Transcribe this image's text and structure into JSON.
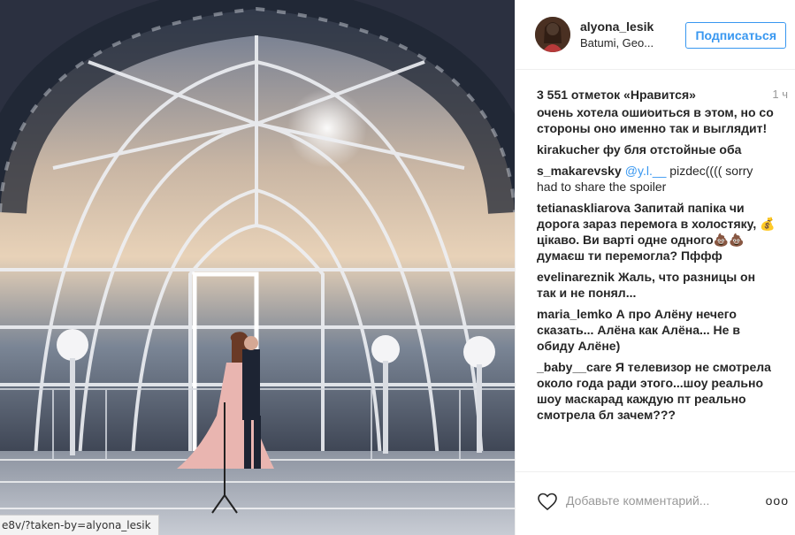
{
  "photo": {
    "description_icon": "wedding-photo"
  },
  "status_bar": {
    "url": "e8v/?taken-by=alyona_lesik"
  },
  "post": {
    "username": "alyona_lesik",
    "location": "Batumi, Geo...",
    "follow_label": "Подписаться",
    "likes": "3 551 отметок «Нравится»",
    "time": "1 ч",
    "comments": [
      {
        "author": "",
        "text": "очень хотела ошибиться в этом, но со стороны оно именно так и выглядит!"
      },
      {
        "author": "kirakucher",
        "text": "фу бля отстойные оба"
      },
      {
        "author": "s_makarevsky",
        "mention": "@y.l.__",
        "text": " pizdec(((( sorry had to share the spoiler"
      },
      {
        "author": "tetianaskliarova",
        "text": "Запитай папіка чи дорога зараз перемога в холостяку, 💰 цікаво. Ви варті одне одного💩💩 думаєш ти перемогла? Пффф"
      },
      {
        "author": "evelinareznik",
        "text": "Жаль, что разницы он так и не понял..."
      },
      {
        "author": "maria_lemko",
        "text": "А про Алёну нечего сказать... Алёна как Алёна... Не в обиду Алёне)"
      },
      {
        "author": "_baby__care",
        "text": "Я телевизор не смотрела около года ради этого...шоу реально шоу маскарад каждую пт реально смотрела бл зачем???"
      }
    ],
    "add_comment_placeholder": "Добавьте комментарий...",
    "more_label": "ooo"
  },
  "colors": {
    "accent": "#3897f0",
    "muted": "#999999",
    "text": "#262626"
  }
}
